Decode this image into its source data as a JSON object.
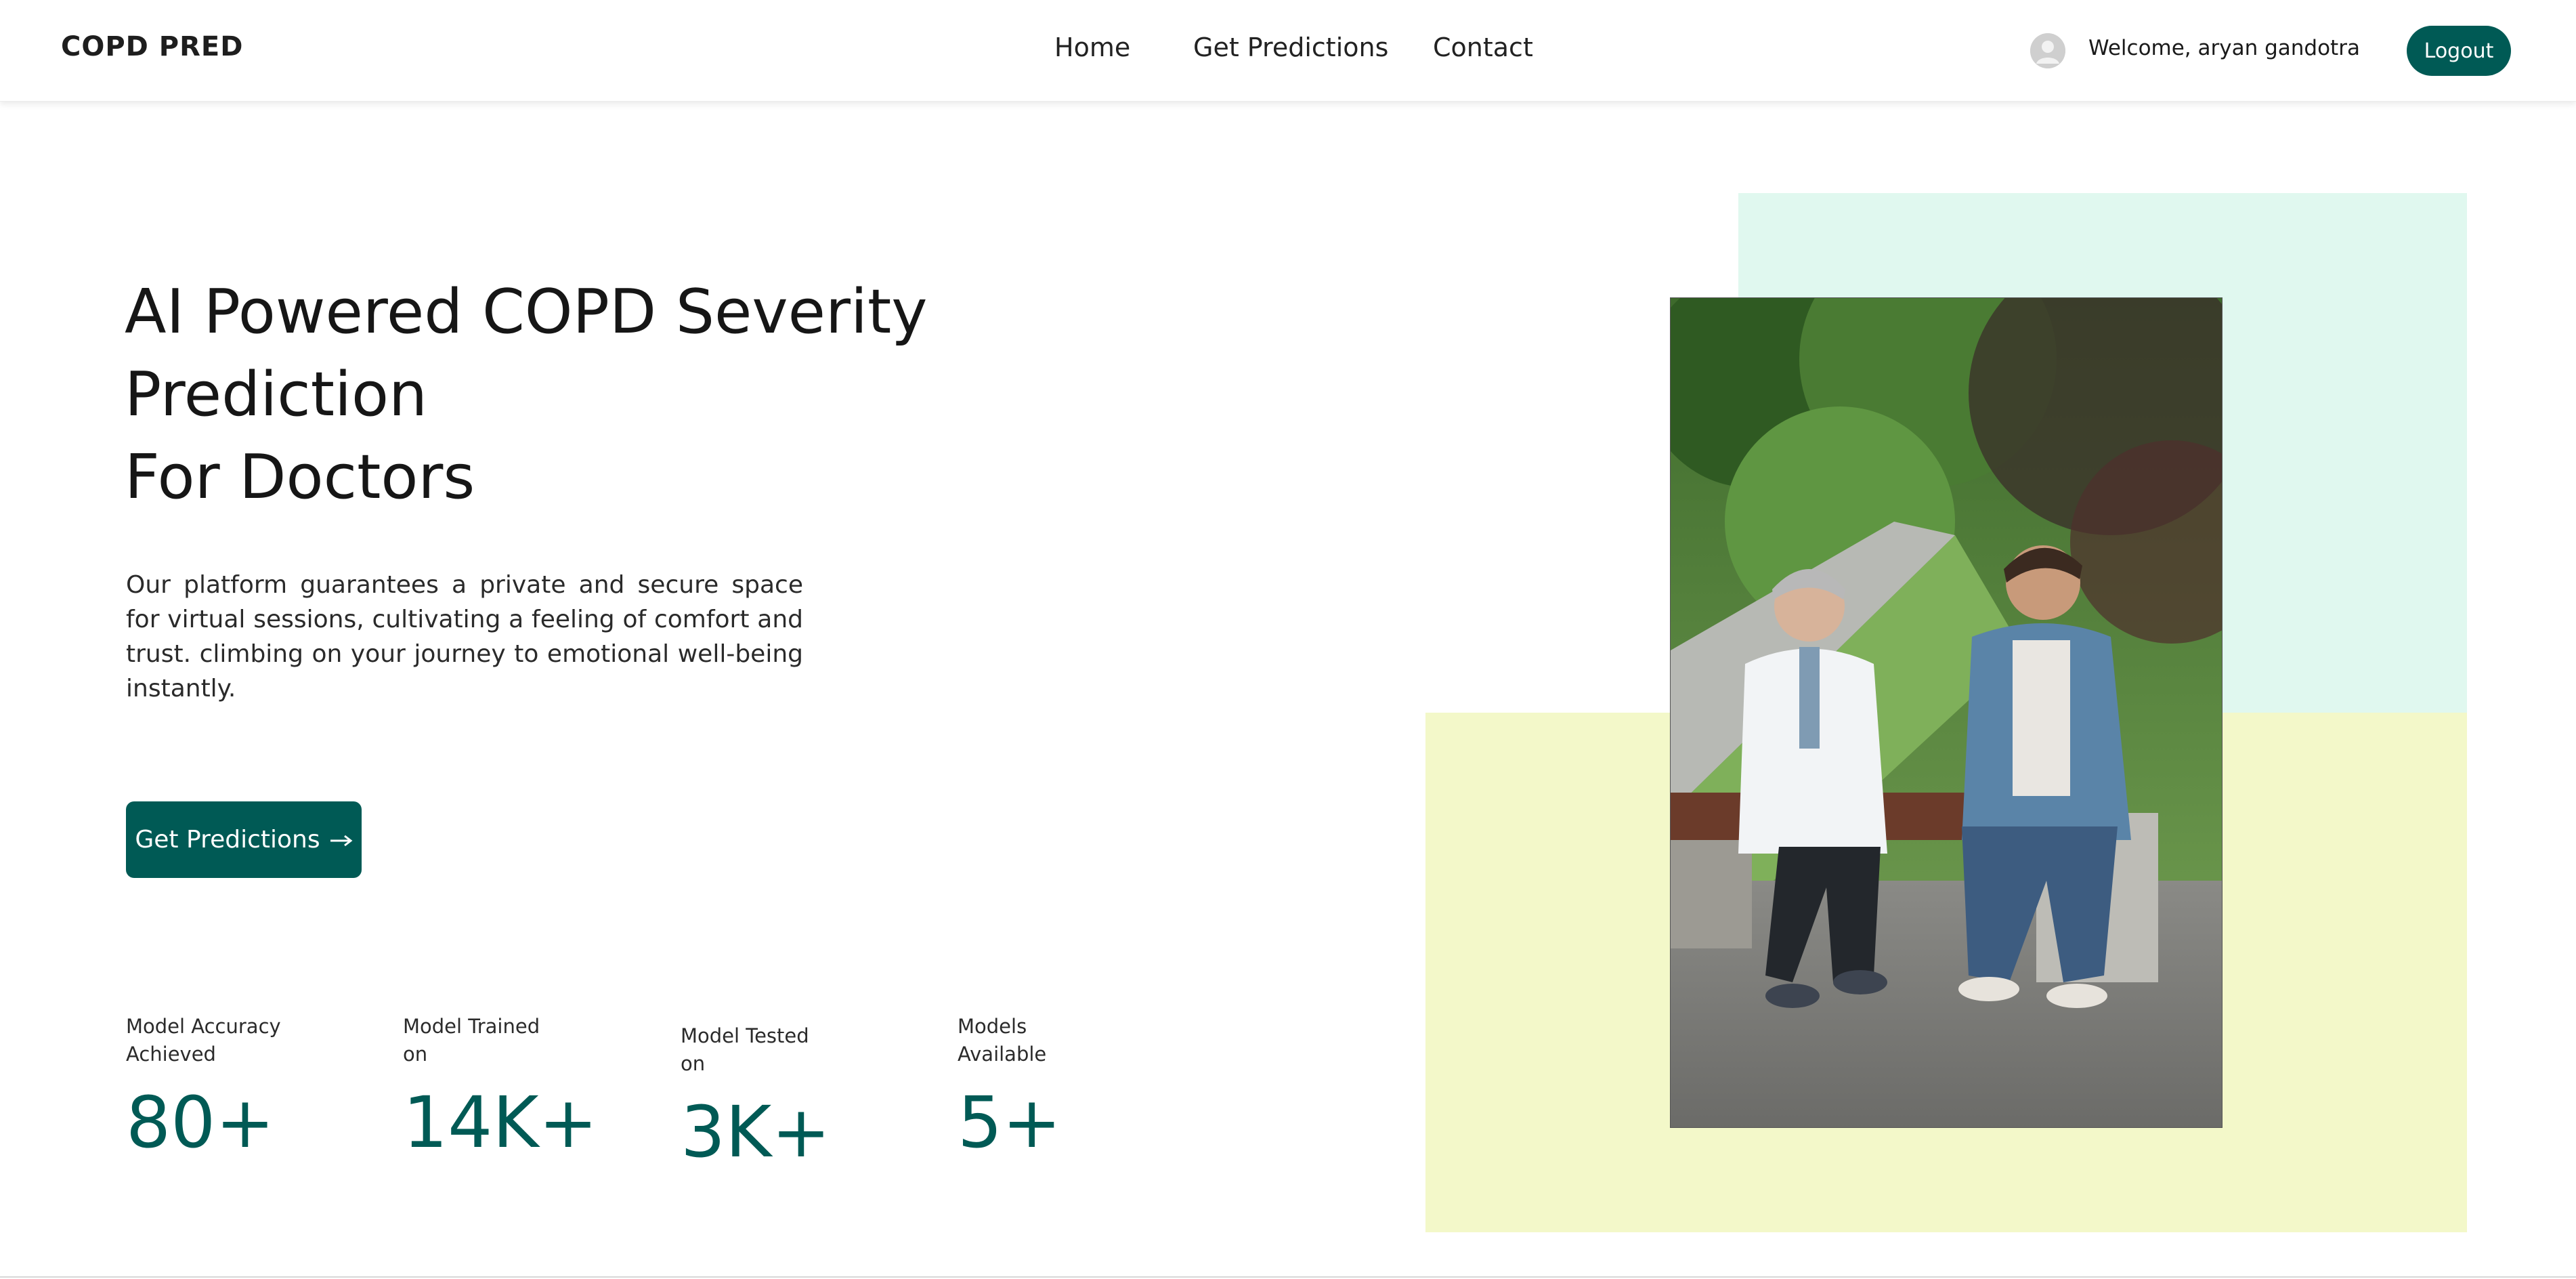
{
  "navbar": {
    "brand": "COPD PRED",
    "links": [
      {
        "label": "Home"
      },
      {
        "label": "Get Predictions"
      },
      {
        "label": "Contact"
      }
    ],
    "welcome": "Welcome, aryan gandotra",
    "logout_label": "Logout",
    "avatar_icon": "user-avatar-icon"
  },
  "hero": {
    "title_line1": "AI Powered COPD Severity Prediction",
    "title_line2": "For Doctors",
    "description": "Our platform guarantees a private and secure space for virtual sessions, cultivating a feeling of comfort and trust. climbing on your journey to emotional well-being instantly.",
    "cta_label": "Get Predictions",
    "cta_icon": "arrow-right-icon"
  },
  "stats": [
    {
      "label": "Model Accuracy Achieved",
      "value": "80+"
    },
    {
      "label": "Model Trained on",
      "value": "14K+"
    },
    {
      "label": "Model Tested on",
      "value": "3K+"
    },
    {
      "label": "Models Available",
      "value": "5+"
    }
  ],
  "colors": {
    "accent": "#005a55",
    "mint_block": "#e0f8ef",
    "lime_block": "#f3f8c9"
  }
}
